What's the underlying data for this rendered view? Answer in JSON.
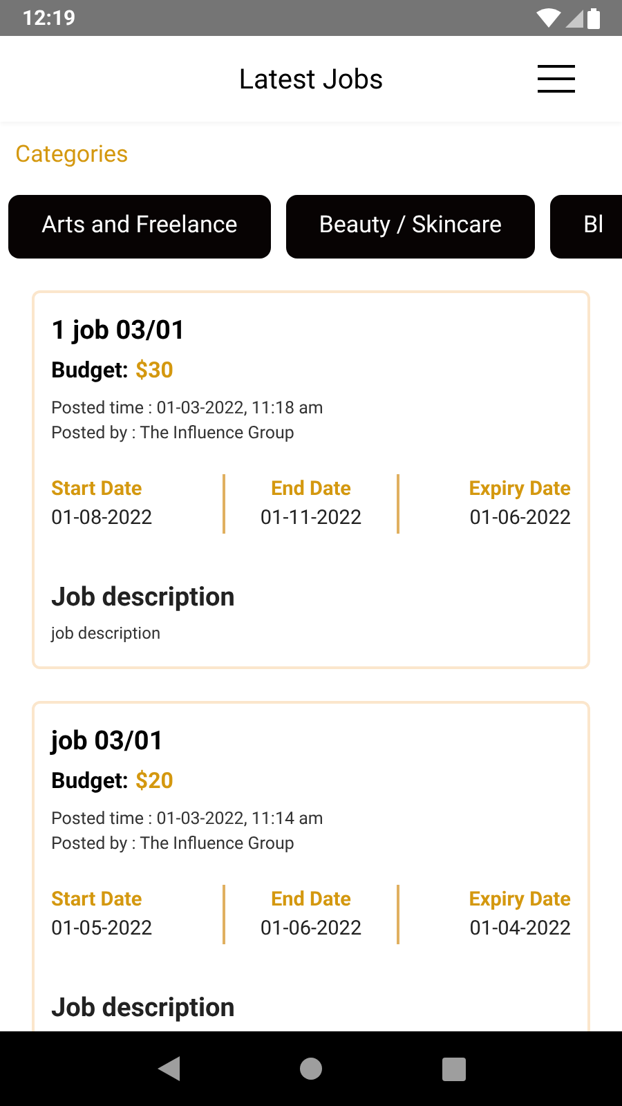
{
  "status_bar": {
    "time": "12:19"
  },
  "header": {
    "title": "Latest Jobs"
  },
  "categories": {
    "label": "Categories",
    "items": [
      {
        "label": "Arts and Freelance"
      },
      {
        "label": "Beauty / Skincare"
      },
      {
        "label": "Bl"
      }
    ]
  },
  "jobs": [
    {
      "title": "1 job 03/01",
      "budget_label": "Budget:",
      "budget": "$30",
      "posted_time": "Posted time : 01-03-2022, 11:18 am",
      "posted_by": "Posted by : The Influence Group",
      "dates": [
        {
          "label": "Start Date",
          "value": "01-08-2022"
        },
        {
          "label": "End Date",
          "value": "01-11-2022"
        },
        {
          "label": "Expiry Date",
          "value": "01-06-2022"
        }
      ],
      "description_title": "Job description",
      "description": "job description"
    },
    {
      "title": "job 03/01",
      "budget_label": "Budget:",
      "budget": "$20",
      "posted_time": "Posted time : 01-03-2022, 11:14 am",
      "posted_by": "Posted by : The Influence Group",
      "dates": [
        {
          "label": "Start Date",
          "value": "01-05-2022"
        },
        {
          "label": "End Date",
          "value": "01-06-2022"
        },
        {
          "label": "Expiry Date",
          "value": "01-04-2022"
        }
      ],
      "description_title": "Job description"
    }
  ]
}
